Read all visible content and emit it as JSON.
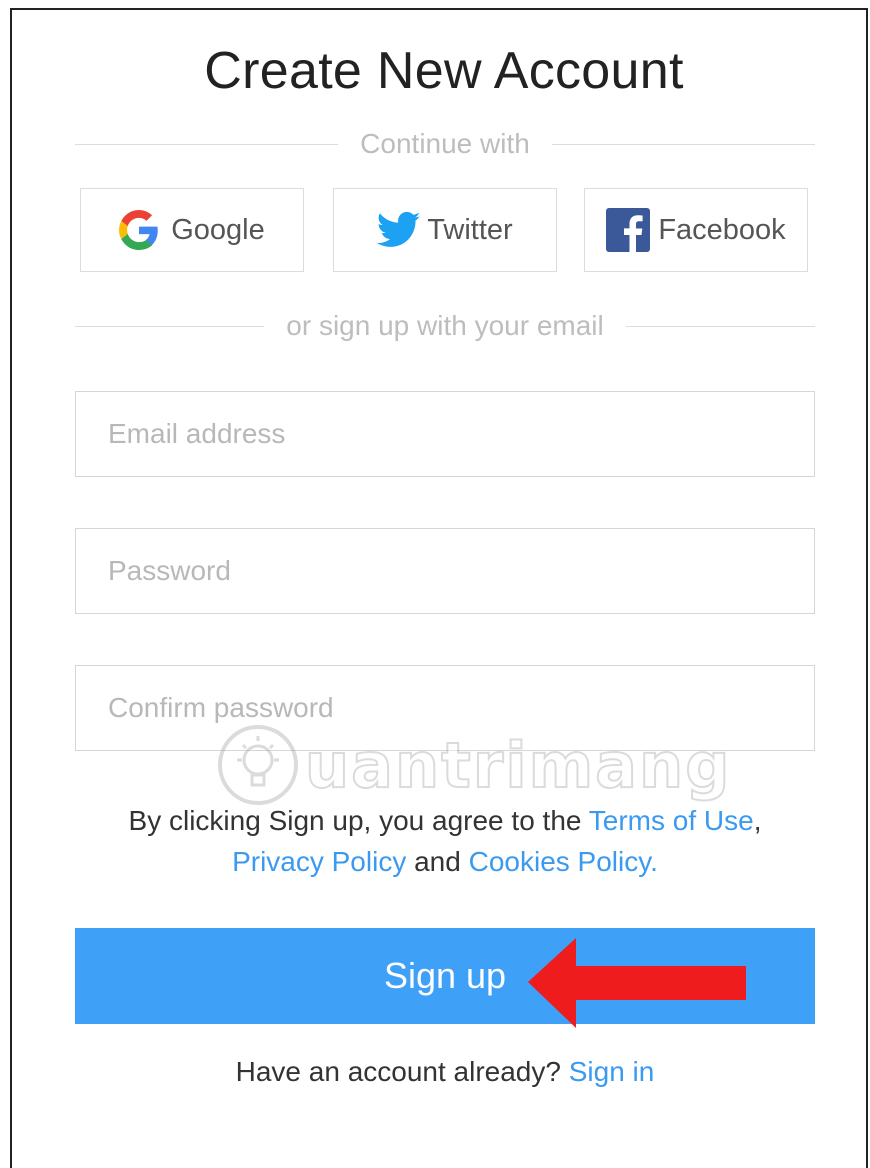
{
  "page": {
    "title": "Create New Account"
  },
  "social": {
    "divider_text": "Continue with",
    "buttons": [
      {
        "label": "Google",
        "icon": "google-icon"
      },
      {
        "label": "Twitter",
        "icon": "twitter-icon"
      },
      {
        "label": "Facebook",
        "icon": "facebook-icon"
      }
    ]
  },
  "email_divider": "or sign up with your email",
  "form": {
    "email_placeholder": "Email address",
    "password_placeholder": "Password",
    "confirm_placeholder": "Confirm password"
  },
  "terms": {
    "prefix": "By clicking Sign up, you agree to the",
    "terms_link": "Terms of Use",
    "comma": ",",
    "privacy_link": "Privacy Policy",
    "and": "and",
    "cookies_link": "Cookies Policy."
  },
  "signup_button": "Sign up",
  "signin": {
    "prompt": "Have an account already?",
    "link": "Sign in"
  },
  "watermark": "uantrimang",
  "colors": {
    "primary_button": "#3ea0f7",
    "link": "#3a9af0",
    "arrow": "#ee1c1c",
    "twitter": "#1da1f2",
    "facebook": "#3b5998"
  }
}
